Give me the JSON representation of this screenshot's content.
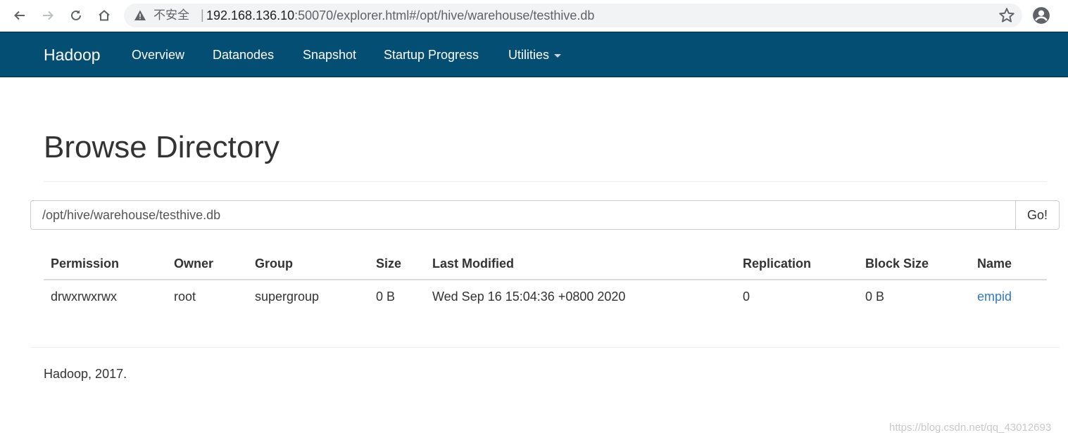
{
  "browser": {
    "insecure_label": "不安全",
    "separator": "|",
    "url_host": "192.168.136.10",
    "url_rest": ":50070/explorer.html#/opt/hive/warehouse/testhive.db"
  },
  "navbar": {
    "brand": "Hadoop",
    "items": [
      {
        "label": "Overview"
      },
      {
        "label": "Datanodes"
      },
      {
        "label": "Snapshot"
      },
      {
        "label": "Startup Progress"
      },
      {
        "label": "Utilities"
      }
    ]
  },
  "page": {
    "title": "Browse Directory",
    "path_value": "/opt/hive/warehouse/testhive.db",
    "go_label": "Go!"
  },
  "table": {
    "headers": [
      "Permission",
      "Owner",
      "Group",
      "Size",
      "Last Modified",
      "Replication",
      "Block Size",
      "Name"
    ],
    "rows": [
      [
        "drwxrwxrwx",
        "root",
        "supergroup",
        "0 B",
        "Wed Sep 16 15:04:36 +0800 2020",
        "0",
        "0 B",
        "empid"
      ]
    ]
  },
  "footer": {
    "text": "Hadoop, 2017."
  },
  "watermark": "https://blog.csdn.net/qq_43012693",
  "colors": {
    "navbar_bg": "#034e72",
    "link": "#337ab7"
  }
}
